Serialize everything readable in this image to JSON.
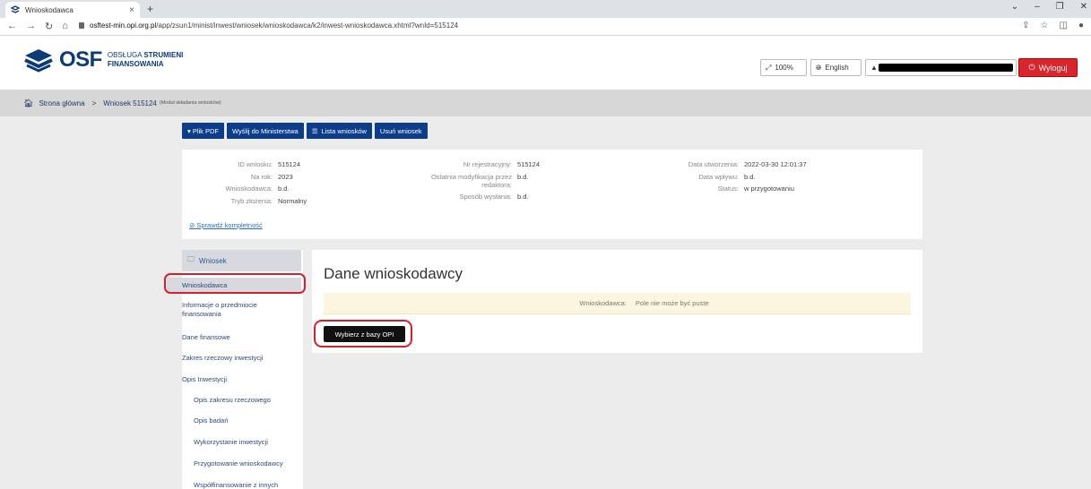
{
  "browser": {
    "tab_title": "Wnioskodawca",
    "tab_close": "×",
    "new_tab": "+",
    "url_host": "osftest-min.opi.org.pl",
    "url_path": "/app/zsun1/minist/inwest/wniosek/wnioskodawca/k2/inwest-wnioskodawca.xhtml?wnId=515124",
    "win_min": "–",
    "win_max": "❐",
    "win_close": "✕",
    "win_collapse": "⌄"
  },
  "header": {
    "logo_text": "OSF",
    "logo_sub1": "OBSŁUGA ",
    "logo_sub1_bold": "STRUMIENI",
    "logo_sub2": "FINANSOWANIA",
    "zoom_label": "100%",
    "lang_label": "English",
    "logout_label": "Wyloguj"
  },
  "breadcrumb": {
    "home": "Strona główna",
    "current": "Wniosek 515124",
    "module": "(Moduł składania wniosków)"
  },
  "toolbar": {
    "pdf": "▾  Plik PDF",
    "send": "Wyślij do Ministerstwa",
    "list": "Lista wniosków",
    "delete": "Usuń wniosek"
  },
  "info": {
    "col1": [
      {
        "label": "ID wniosku:",
        "value": "515124"
      },
      {
        "label": "Na rok:",
        "value": "2023"
      },
      {
        "label": "Wnioskodawca:",
        "value": "b.d."
      },
      {
        "label": "Tryb złożenia:",
        "value": "Normalny"
      }
    ],
    "col2": [
      {
        "label": "Nr rejestracyjny:",
        "value": "515124"
      },
      {
        "label": "Ostatnia modyfikacja przez redaktora:",
        "value": "b.d."
      },
      {
        "label": "Sposób wysłania:",
        "value": "b.d."
      }
    ],
    "col3": [
      {
        "label": "Data utworzenia:",
        "value": "2022-03-30 12:01:37"
      },
      {
        "label": "Data wpływu:",
        "value": "b.d."
      },
      {
        "label": "Status:",
        "value": "w przygotowaniu"
      }
    ],
    "check_link": "Sprawdź kompletność"
  },
  "sidebar": {
    "head": "Wniosek",
    "items": [
      "Wnioskodawca",
      "Informacje o przedmiocie finansowania",
      "Dane finansowe",
      "Zakres rzeczowy inwestycji",
      "Opis Inwestycji",
      "Opis zakresu rzeczowego",
      "Opis badań",
      "Wykorzystanie inwestycji",
      "Przygotowanie wnioskodawcy",
      "Współfinansowanie z innych"
    ]
  },
  "main": {
    "title": "Dane wnioskodawcy",
    "alert_label": "Wnioskodawca:",
    "alert_msg": "Pole nie może być puste",
    "pick_button": "Wybierz z bazy OPI"
  },
  "colors": {
    "brand": "#0c3c78",
    "toolbar": "#0c3d8a",
    "logout": "#d9262c",
    "highlight": "#d8202a"
  }
}
